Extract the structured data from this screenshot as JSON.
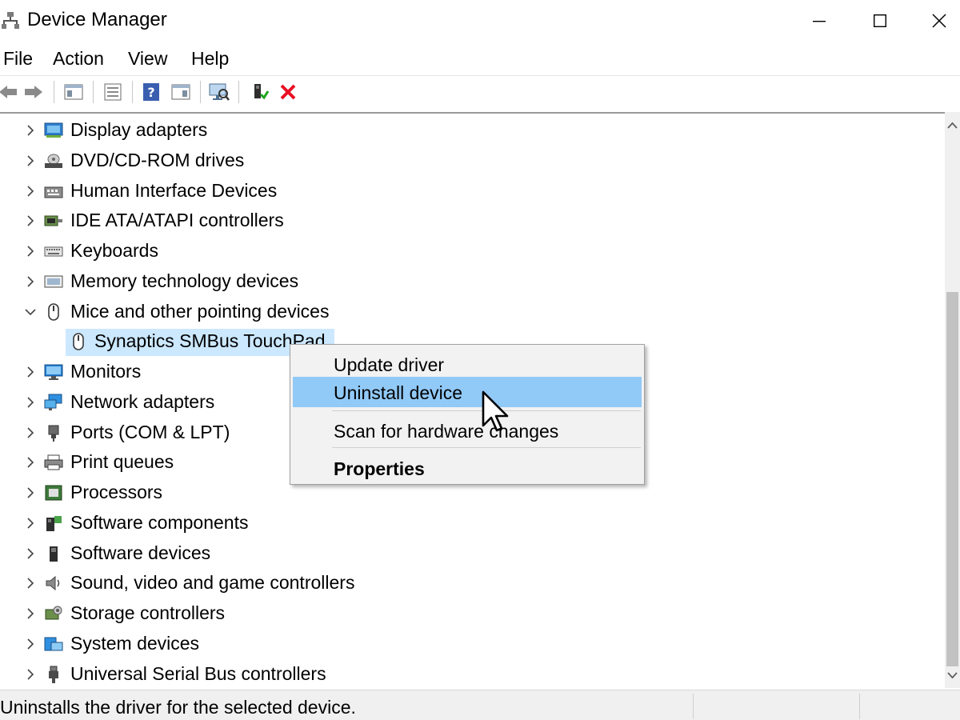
{
  "window": {
    "title": "Device Manager",
    "icon": "device-manager-icon"
  },
  "menu": [
    "File",
    "Action",
    "View",
    "Help"
  ],
  "toolbar": {
    "buttons": [
      "back-arrow-icon",
      "forward-arrow-icon",
      "show-hide-tree-icon",
      "properties-icon",
      "help-icon",
      "action-pane-icon",
      "scan-hardware-icon",
      "enable-device-icon",
      "uninstall-x-icon"
    ],
    "uninstall_color": "#e81123"
  },
  "tree": {
    "items": [
      {
        "label": "Display adapters",
        "icon": "display-adapter-icon",
        "expanded": false
      },
      {
        "label": "DVD/CD-ROM drives",
        "icon": "dvd-drive-icon",
        "expanded": false
      },
      {
        "label": "Human Interface Devices",
        "icon": "hid-icon",
        "expanded": false
      },
      {
        "label": "IDE ATA/ATAPI controllers",
        "icon": "ide-controller-icon",
        "expanded": false
      },
      {
        "label": "Keyboards",
        "icon": "keyboard-icon",
        "expanded": false
      },
      {
        "label": "Memory technology devices",
        "icon": "memory-device-icon",
        "expanded": false
      },
      {
        "label": "Mice and other pointing devices",
        "icon": "mouse-icon",
        "expanded": true
      },
      {
        "label": "Synaptics SMBus TouchPad",
        "icon": "mouse-icon",
        "child": true,
        "selected": true
      },
      {
        "label": "Monitors",
        "icon": "monitor-icon",
        "expanded": false
      },
      {
        "label": "Network adapters",
        "icon": "network-adapter-icon",
        "expanded": false
      },
      {
        "label": "Ports (COM & LPT)",
        "icon": "port-icon",
        "expanded": false
      },
      {
        "label": "Print queues",
        "icon": "printer-icon",
        "expanded": false
      },
      {
        "label": "Processors",
        "icon": "processor-icon",
        "expanded": false
      },
      {
        "label": "Software components",
        "icon": "software-component-icon",
        "expanded": false
      },
      {
        "label": "Software devices",
        "icon": "software-device-icon",
        "expanded": false
      },
      {
        "label": "Sound, video and game controllers",
        "icon": "speaker-icon",
        "expanded": false
      },
      {
        "label": "Storage controllers",
        "icon": "storage-controller-icon",
        "expanded": false
      },
      {
        "label": "System devices",
        "icon": "system-device-icon",
        "expanded": false
      },
      {
        "label": "Universal Serial Bus controllers",
        "icon": "usb-icon",
        "expanded": false
      }
    ]
  },
  "context_menu": {
    "items": [
      {
        "label": "Update driver"
      },
      {
        "label": "Uninstall device",
        "highlighted": true
      },
      {
        "label": "Scan for hardware changes"
      },
      {
        "label": "Properties",
        "bold": true
      }
    ]
  },
  "status": {
    "text": "Uninstalls the driver for the selected device."
  },
  "colors": {
    "selection": "#cce8ff",
    "menu_highlight": "#91c9f7",
    "menu_background": "#f2f2f2"
  }
}
